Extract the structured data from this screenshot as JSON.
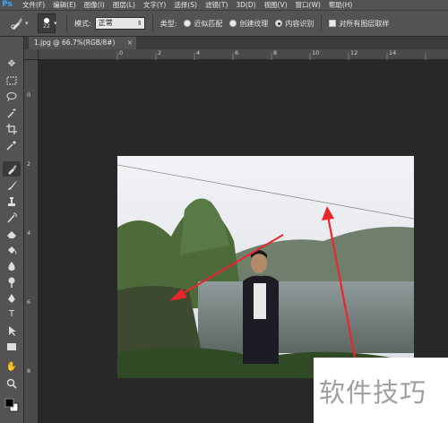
{
  "app": {
    "logo": "Ps"
  },
  "menu": [
    "文件(F)",
    "编辑(E)",
    "图像(I)",
    "图层(L)",
    "文字(Y)",
    "选择(S)",
    "滤镜(T)",
    "3D(D)",
    "视图(V)",
    "窗口(W)",
    "帮助(H)"
  ],
  "options": {
    "brush_size": "22",
    "mode_label": "模式:",
    "mode_value": "正常",
    "type_label": "类型:",
    "type_options": [
      "近似匹配",
      "创建纹理",
      "内容识别"
    ],
    "type_selected": "内容识别",
    "sample_all_layers": "对所有图层取样"
  },
  "document": {
    "tab_title": "1.jpg @ 66.7%(RGB/8#)",
    "close_glyph": "×"
  },
  "ruler_top_labels": [
    "0",
    "2",
    "4",
    "6",
    "8",
    "10",
    "12",
    "14"
  ],
  "ruler_left_labels": [
    "0",
    "2",
    "4",
    "6",
    "8"
  ],
  "tools": [
    "move-icon",
    "marquee-icon",
    "lasso-icon",
    "magic-wand-icon",
    "crop-icon",
    "eyedropper-icon",
    "spot-healing-brush-icon",
    "brush-icon",
    "clone-stamp-icon",
    "history-brush-icon",
    "eraser-icon",
    "paint-bucket-icon",
    "blur-icon",
    "dodge-icon",
    "pen-icon",
    "type-icon",
    "path-selection-icon",
    "rectangle-icon",
    "hand-icon",
    "zoom-icon"
  ],
  "watermark": {
    "text": "软件技巧"
  },
  "colors": {
    "panel": "#535353",
    "canvas": "#282828",
    "arrow": "#e8262b",
    "accent": "#31a8ff"
  }
}
